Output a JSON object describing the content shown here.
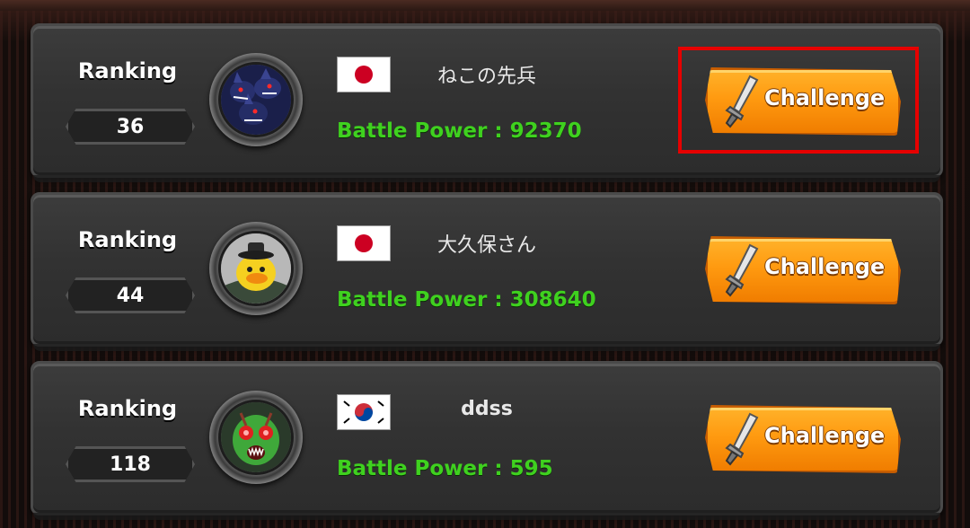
{
  "ranking_label": "Ranking",
  "button_label": "Challenge",
  "accent": {
    "battle_power_color": "#3fd11f",
    "button_color": "#ff9a10",
    "highlight_color": "#e60000"
  },
  "players": [
    {
      "rank": "36",
      "name": "ねこの先兵",
      "flag": "japan-flag-icon",
      "avatar": "three-headed-dog-avatar-icon",
      "battle_power": "Battle Power : 92370"
    },
    {
      "rank": "44",
      "name": "大久保さん",
      "flag": "japan-flag-icon",
      "avatar": "yellow-penguin-warrior-avatar-icon",
      "battle_power": "Battle Power : 308640"
    },
    {
      "rank": "118",
      "name": "ddss",
      "flag": "south-korea-flag-icon",
      "avatar": "green-alien-avatar-icon",
      "battle_power": "Battle Power : 595"
    }
  ]
}
